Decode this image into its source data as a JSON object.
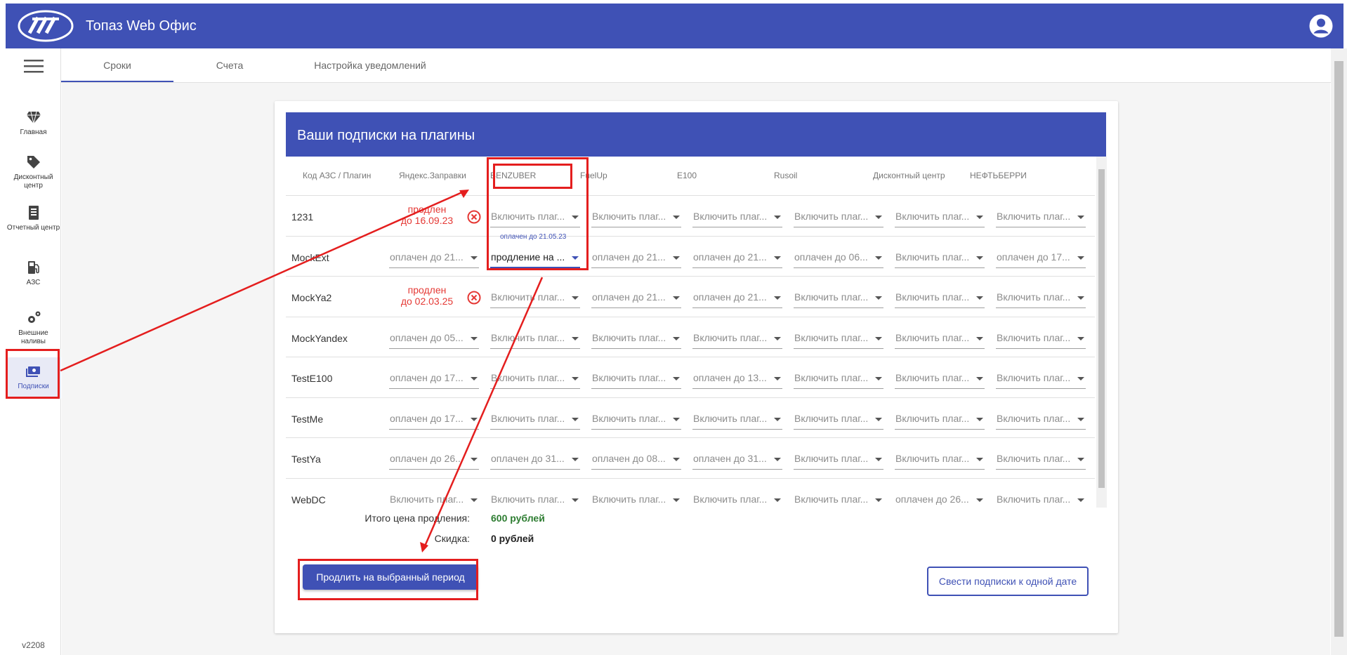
{
  "header": {
    "title": "Топаз Web Офис"
  },
  "nav": {
    "items": [
      {
        "label": "Главная",
        "icon": "home-diamond-icon"
      },
      {
        "label": "Дисконтный центр",
        "icon": "tag-icon"
      },
      {
        "label": "Отчетный центр",
        "icon": "report-icon"
      },
      {
        "label": "АЗС",
        "icon": "fuel-icon"
      },
      {
        "label": "Внешние наливы",
        "icon": "gears-icon"
      },
      {
        "label": "Подписки",
        "icon": "money-icon"
      }
    ],
    "version": "v2208"
  },
  "tabs": [
    {
      "label": "Сроки"
    },
    {
      "label": "Счета"
    },
    {
      "label": "Настройка уведомлений"
    }
  ],
  "card": {
    "title": "Ваши подписки на плагины",
    "columns": [
      "Код АЗС / Плагин",
      "Яндекс.Заправки",
      "BENZUBER",
      "FuelUp",
      "E100",
      "Rusoil",
      "Дисконтный центр",
      "НЕФТЬБЕРРИ"
    ],
    "rows": [
      {
        "code": "1231",
        "expired": [
          "продлен",
          "до 16.09.23"
        ],
        "cells": [
          "Включить плаг...",
          "Включить плаг...",
          "Включить плаг...",
          "Включить плаг...",
          "Включить плаг...",
          "Включить плаг..."
        ]
      },
      {
        "code": "MockExt",
        "cells": [
          "оплачен до 21...",
          "продление на ...",
          "оплачен до 21...",
          "оплачен до 21...",
          "оплачен до 06...",
          "Включить плаг...",
          "оплачен до 17..."
        ],
        "float_label": "оплачен до 21.05.23"
      },
      {
        "code": "MockYa2",
        "expired": [
          "продлен",
          "до 02.03.25"
        ],
        "cells": [
          "Включить плаг...",
          "оплачен до 21...",
          "оплачен до 21...",
          "Включить плаг...",
          "Включить плаг...",
          "Включить плаг..."
        ]
      },
      {
        "code": "MockYandex",
        "cells": [
          "оплачен до 05...",
          "Включить плаг...",
          "Включить плаг...",
          "Включить плаг...",
          "Включить плаг...",
          "Включить плаг...",
          "Включить плаг..."
        ]
      },
      {
        "code": "TestE100",
        "cells": [
          "оплачен до 17...",
          "Включить плаг...",
          "Включить плаг...",
          "оплачен до 13...",
          "Включить плаг...",
          "Включить плаг...",
          "Включить плаг..."
        ]
      },
      {
        "code": "TestMe",
        "cells": [
          "оплачен до 17...",
          "Включить плаг...",
          "Включить плаг...",
          "Включить плаг...",
          "Включить плаг...",
          "Включить плаг...",
          "Включить плаг..."
        ]
      },
      {
        "code": "TestYa",
        "cells": [
          "оплачен до 26...",
          "оплачен до 31...",
          "оплачен до 08...",
          "оплачен до 31...",
          "Включить плаг...",
          "Включить плаг...",
          "Включить плаг..."
        ]
      },
      {
        "code": "WebDC",
        "cells": [
          "Включить плаг...",
          "Включить плаг...",
          "Включить плаг...",
          "Включить плаг...",
          "Включить плаг...",
          "оплачен до 26...",
          "Включить плаг..."
        ]
      }
    ],
    "totals": {
      "total_label": "Итого цена продления:",
      "total_value": "600 рублей",
      "discount_label": "Скидка:",
      "discount_value": "0 рублей"
    },
    "extend_button": "Продлить на выбранный период",
    "align_button": "Свести подписки к одной дате"
  },
  "colors": {
    "primary": "#3f51b5",
    "annotation": "#e41e1e",
    "expired": "#e53935",
    "total": "#2e7d32"
  }
}
